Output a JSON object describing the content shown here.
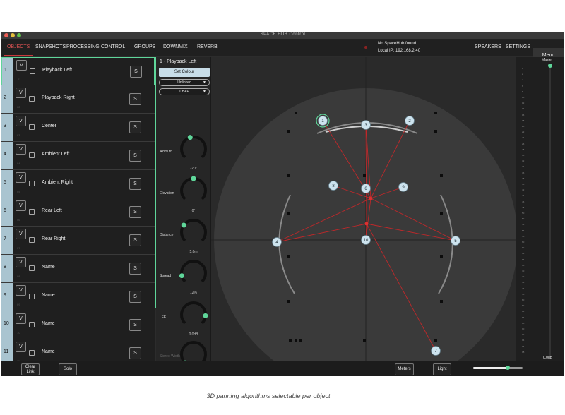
{
  "window": {
    "title": "SPACE HUB Control"
  },
  "nav": {
    "items": [
      "OBJECTS",
      "SNAPSHOTS",
      "PROCESSING",
      "CONTROL",
      "GROUPS",
      "DOWNMIX",
      "REVERB"
    ],
    "active": "OBJECTS",
    "status_line1": "No SpaceHub found",
    "status_line2": "Local IP: 192.168.2.40",
    "right_items": [
      "SPEAKERS",
      "SETTINGS"
    ],
    "menu_label": "Menu"
  },
  "objects": [
    {
      "num": "1",
      "name": "Playback Left",
      "v": "V",
      "s": "S",
      "sub": "01"
    },
    {
      "num": "2",
      "name": "Playback Right",
      "v": "V",
      "s": "S",
      "sub": "02"
    },
    {
      "num": "3",
      "name": "Center",
      "v": "V",
      "s": "S",
      "sub": "03"
    },
    {
      "num": "4",
      "name": "Ambient Left",
      "v": "V",
      "s": "S",
      "sub": "04"
    },
    {
      "num": "5",
      "name": "Ambient Right",
      "v": "V",
      "s": "S",
      "sub": "05"
    },
    {
      "num": "6",
      "name": "Rear Left",
      "v": "V",
      "s": "S",
      "sub": "06"
    },
    {
      "num": "7",
      "name": "Rear Right",
      "v": "V",
      "s": "S",
      "sub": "07"
    },
    {
      "num": "8",
      "name": "Name",
      "v": "V",
      "s": "S",
      "sub": "08"
    },
    {
      "num": "9",
      "name": "Name",
      "v": "V",
      "s": "S",
      "sub": "09"
    },
    {
      "num": "10",
      "name": "Name",
      "v": "V",
      "s": "S",
      "sub": "10"
    },
    {
      "num": "11",
      "name": "Name",
      "v": "V",
      "s": "S",
      "sub": "11"
    }
  ],
  "panel": {
    "title": "1 -    Playback Left",
    "set_colour": "Set Colour",
    "link_mode": "Unlinked",
    "algorithm": "DBAP",
    "params": [
      {
        "label": "Azimuth",
        "value": "-20°",
        "level": 0.44
      },
      {
        "label": "Elevation",
        "value": "0°",
        "level": 0.5
      },
      {
        "label": "Distance",
        "value": "5.0m",
        "level": 0.3
      },
      {
        "label": "Spread",
        "value": "12%",
        "level": 0.12
      },
      {
        "label": "LFE",
        "value": "0.0dB",
        "level": 0.85
      },
      {
        "label": "Stereo Width",
        "value": "0%",
        "level": 0.0
      }
    ],
    "hide_label": "Hide"
  },
  "speakers": [
    {
      "id": "1",
      "selected": true
    },
    {
      "id": "2"
    },
    {
      "id": "3"
    },
    {
      "id": "4"
    },
    {
      "id": "5"
    },
    {
      "id": "6"
    },
    {
      "id": "7"
    },
    {
      "id": "8"
    },
    {
      "id": "9"
    },
    {
      "id": "10"
    }
  ],
  "meter": {
    "master_label": "Master",
    "master_value": "0.0dB",
    "scale": [
      "0",
      "2",
      "4",
      "6",
      "8",
      "10",
      "12",
      "14",
      "16",
      "18",
      "20",
      "22",
      "24",
      "26",
      "28",
      "30",
      "32",
      "34",
      "36",
      "38",
      "40",
      "42",
      "44",
      "46",
      "48",
      "50",
      "52",
      "54",
      "56",
      "58",
      "60",
      "62",
      "64",
      "66",
      "68",
      "70",
      "72",
      "74",
      "76",
      "78",
      "80",
      "82",
      "84",
      "86",
      "88",
      "90",
      "92",
      "94",
      "96",
      "98"
    ]
  },
  "bottom": {
    "clear_link": "Clear Link",
    "solo": "Solo",
    "meters": "Meters",
    "light": "Light",
    "slider_level": 0.7
  },
  "caption": "3D panning algorithms selectable per object",
  "colors": {
    "accent": "#5fd69a",
    "active_nav": "#e05454",
    "object_num_bg": "#a9c4d0",
    "speaker_fill": "#cde3ee",
    "lines": "#c0282a"
  }
}
